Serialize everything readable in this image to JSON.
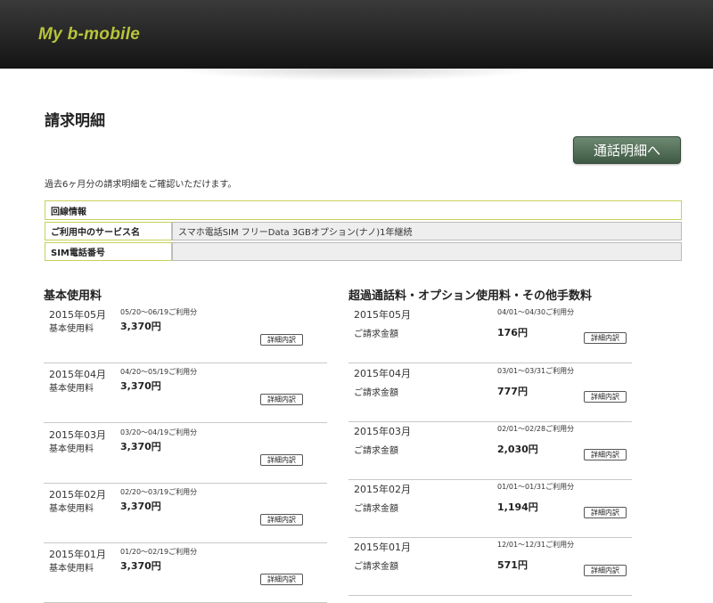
{
  "header": {
    "logo": "My b-mobile"
  },
  "page": {
    "title": "請求明細",
    "call_button": "通話明細へ",
    "intro": "過去6ヶ月分の請求明細をご確認いただけます。"
  },
  "line_info": {
    "heading": "回線情報",
    "service_label": "ご利用中のサービス名",
    "service_value": "スマホ電話SIM フリーData 3GBオプション(ナノ)1年継続",
    "sim_label": "SIM電話番号",
    "sim_value": ""
  },
  "basic": {
    "title": "基本使用料",
    "items": [
      {
        "month": "2015年05月",
        "label": "基本使用料",
        "period": "05/20〜06/19ご利用分",
        "amount": "3,370円",
        "detail": "詳細内訳"
      },
      {
        "month": "2015年04月",
        "label": "基本使用料",
        "period": "04/20〜05/19ご利用分",
        "amount": "3,370円",
        "detail": "詳細内訳"
      },
      {
        "month": "2015年03月",
        "label": "基本使用料",
        "period": "03/20〜04/19ご利用分",
        "amount": "3,370円",
        "detail": "詳細内訳"
      },
      {
        "month": "2015年02月",
        "label": "基本使用料",
        "period": "02/20〜03/19ご利用分",
        "amount": "3,370円",
        "detail": "詳細内訳"
      },
      {
        "month": "2015年01月",
        "label": "基本使用料",
        "period": "01/20〜02/19ご利用分",
        "amount": "3,370円",
        "detail": "詳細内訳"
      }
    ]
  },
  "extra": {
    "title": "超過通話料・オプション使用料・その他手数料",
    "items": [
      {
        "month": "2015年05月",
        "label": "ご請求金額",
        "period": "04/01〜04/30ご利用分",
        "amount": "176円",
        "detail": "詳細内訳"
      },
      {
        "month": "2015年04月",
        "label": "ご請求金額",
        "period": "03/01〜03/31ご利用分",
        "amount": "777円",
        "detail": "詳細内訳"
      },
      {
        "month": "2015年03月",
        "label": "ご請求金額",
        "period": "02/01〜02/28ご利用分",
        "amount": "2,030円",
        "detail": "詳細内訳"
      },
      {
        "month": "2015年02月",
        "label": "ご請求金額",
        "period": "01/01〜01/31ご利用分",
        "amount": "1,194円",
        "detail": "詳細内訳"
      },
      {
        "month": "2015年01月",
        "label": "ご請求金額",
        "period": "12/01〜12/31ご利用分",
        "amount": "571円",
        "detail": "詳細内訳"
      }
    ]
  },
  "colors": {
    "logo": "#b8c43a",
    "button": "#4f6b54",
    "table_border": "#c6d15a"
  }
}
